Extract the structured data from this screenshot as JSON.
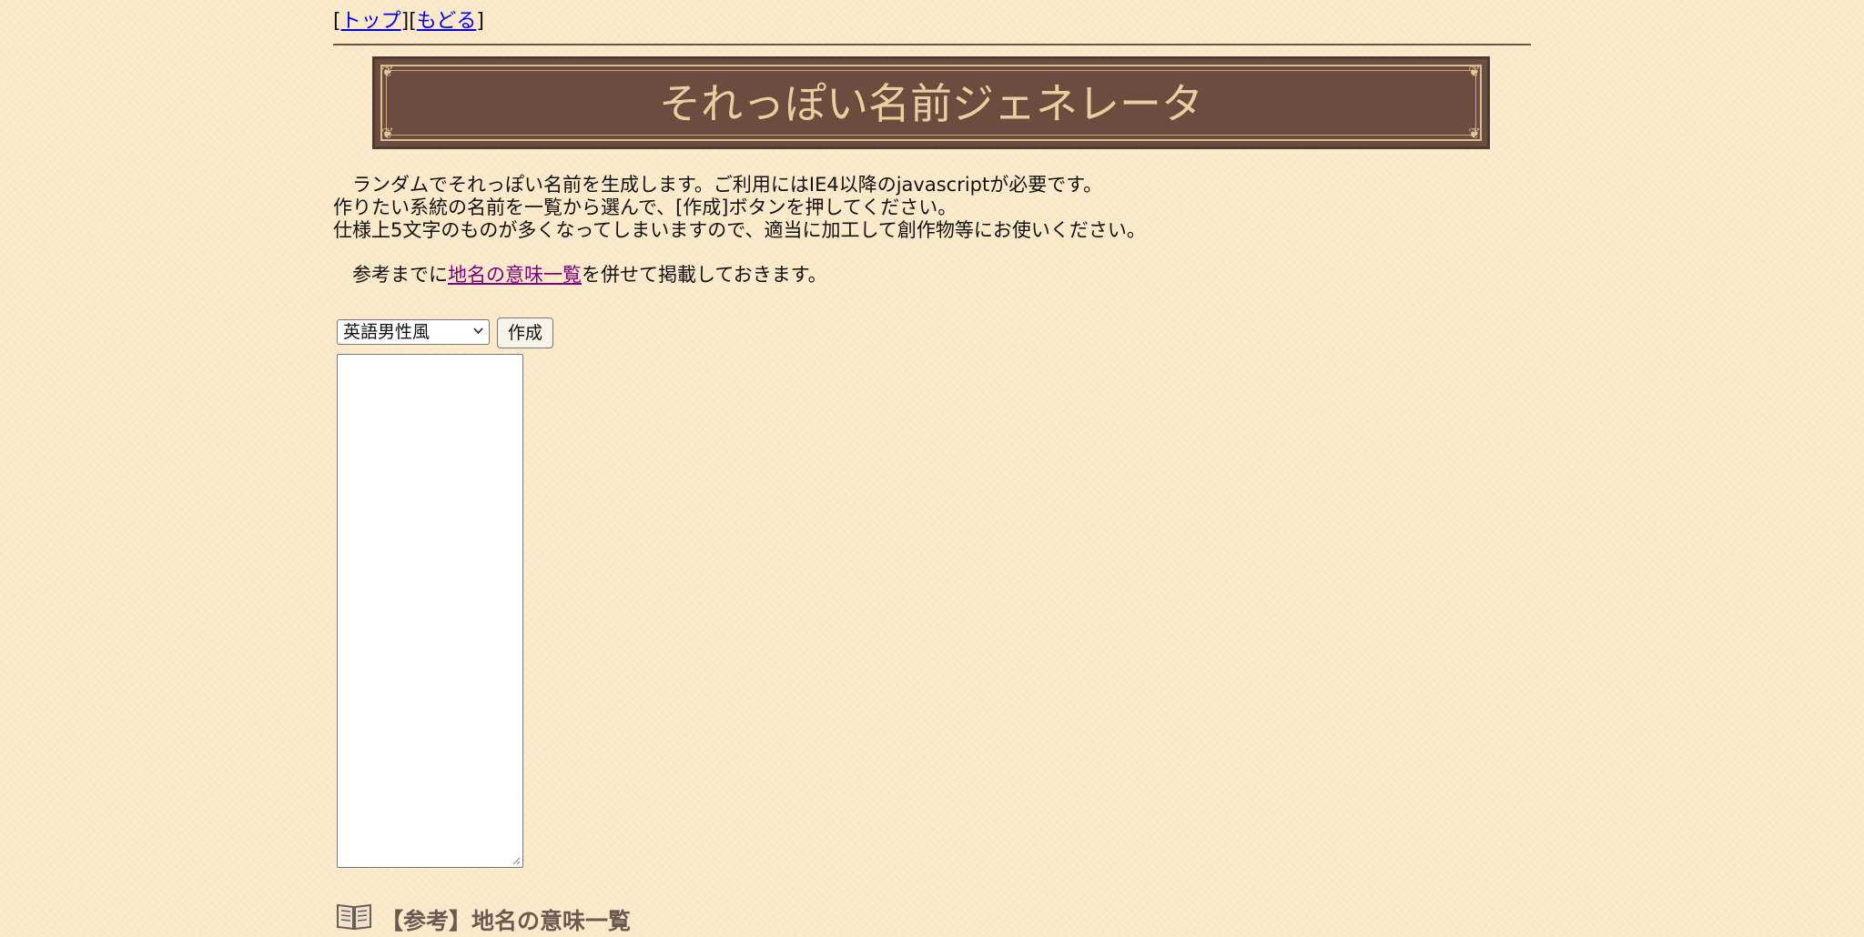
{
  "nav": {
    "open_bracket_1": "[",
    "top_link": "トップ",
    "mid_bracket": "][",
    "back_link": "もどる",
    "close_bracket_2": "]"
  },
  "banner": {
    "title": "それっぽい名前ジェネレータ"
  },
  "intro": {
    "line1": "　ランダムでそれっぽい名前を生成します。ご利用にはIE4以降のjavascriptが必要です。",
    "line2": "作りたい系統の名前を一覧から選んで、[作成]ボタンを押してください。",
    "line3": "仕様上5文字のものが多くなってしまいますので、適当に加工して創作物等にお使いください。"
  },
  "reference": {
    "prefix": "　参考までに",
    "link": "地名の意味一覧",
    "suffix": "を併せて掲載しておきます。"
  },
  "form": {
    "select_value": "英語男性風",
    "create_button": "作成",
    "output_value": ""
  },
  "section": {
    "heading": "【参考】地名の意味一覧"
  },
  "colors": {
    "page_background": "#fbe9c9",
    "banner_background": "#6b4c3f",
    "banner_text": "#e9cf9f",
    "link": "#0000ee",
    "visited_link": "#800080"
  },
  "icons": {
    "select_arrow": "chevron-down-icon",
    "section_icon": "book-icon",
    "textarea_handle": "resize-handle-icon"
  }
}
